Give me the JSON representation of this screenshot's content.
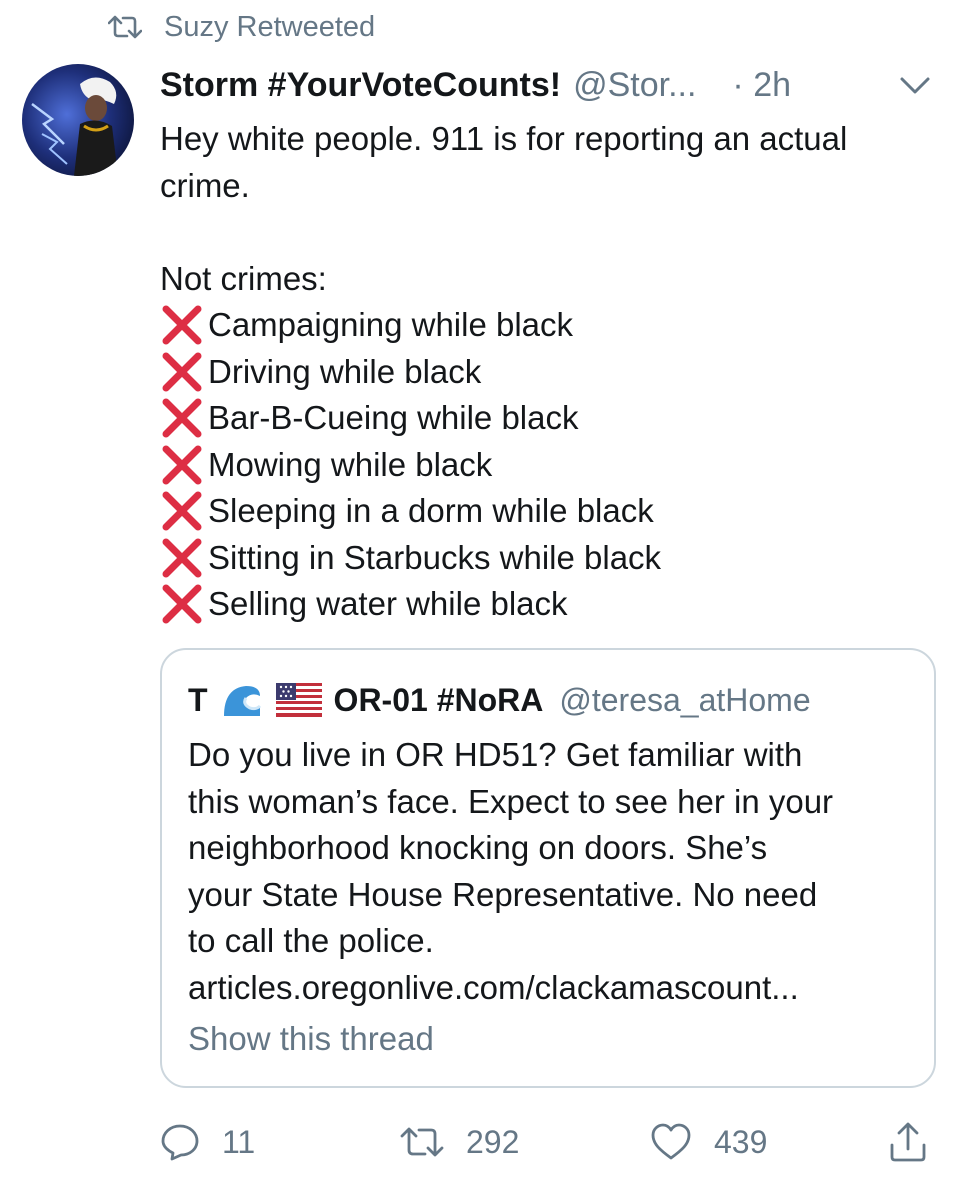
{
  "retweet_bar": {
    "icon": "retweet-icon",
    "text": "Suzy Retweeted"
  },
  "tweet": {
    "avatar": "avatar-image",
    "display_name": "Storm #YourVoteCounts!",
    "handle": "@Stor...",
    "time": "· 2h",
    "menu_icon": "chevron-down-icon",
    "intro_lines": [
      "Hey white people. 911 is for reporting an actual",
      "crime."
    ],
    "list_heading": "Not crimes:",
    "list_items": [
      "Campaigning while black",
      "Driving while black",
      "Bar-B-Cueing while black",
      "Mowing while black",
      "Sleeping in a dorm while black",
      "Sitting in Starbucks while black",
      "Selling water while black"
    ],
    "list_marker_icon": "cross-mark-icon",
    "colors": {
      "cross_mark": "#dd2e44",
      "secondary_text": "#657786",
      "border": "#ccd6dd"
    }
  },
  "quote": {
    "name_initial": "T",
    "name_rest": "OR-01 #NoRA",
    "handle": "@teresa_atHome",
    "wave_icon": "water-wave-icon",
    "flag_icon": "us-flag-icon",
    "lines": [
      "Do you live in OR HD51? Get familiar with",
      "this woman’s face. Expect to see her in your",
      "neighborhood knocking on doors. She’s",
      "your State House Representative. No need",
      "to call the police.",
      "articles.oregonlive.com/clackamascount..."
    ],
    "show_thread": "Show this thread"
  },
  "actions": {
    "reply_count": "11",
    "retweet_count": "292",
    "like_count": "439",
    "icons": [
      "reply-icon",
      "retweet-icon",
      "heart-icon",
      "share-icon"
    ]
  }
}
